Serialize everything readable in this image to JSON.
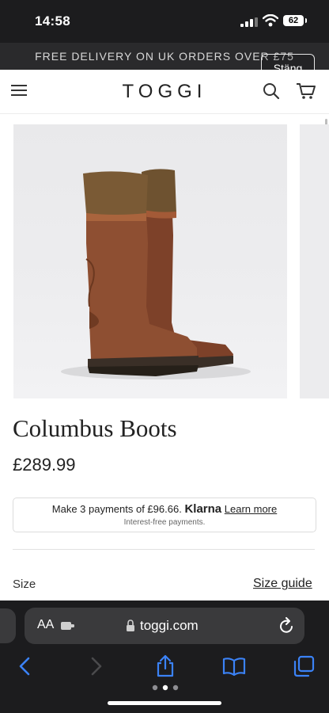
{
  "status_bar": {
    "time": "14:58",
    "battery": "62"
  },
  "promo": {
    "text": "FREE DELIVERY ON UK ORDERS OVER £75",
    "close_label": "Stäng"
  },
  "header": {
    "logo": "TOGGI"
  },
  "product": {
    "title": "Columbus Boots",
    "price": "£289.99",
    "klarna": {
      "prefix": "Make 3 payments of £96.66.",
      "brand": "Klarna",
      "learn_more": "Learn more",
      "note": "Interest-free payments."
    },
    "size_label": "Size",
    "size_guide": "Size guide"
  },
  "browser": {
    "text_size_label": "AA",
    "url": "toggi.com",
    "tab_dots": 3,
    "active_dot": 2
  },
  "colors": {
    "boot_leather": "#8e4f32",
    "boot_cuff": "#7a5a35",
    "toolbar_blue": "#3b82f6"
  },
  "icons": [
    "hamburger-icon",
    "search-icon",
    "cart-icon",
    "extension-icon",
    "lock-icon",
    "reload-icon",
    "back-icon",
    "forward-icon",
    "share-icon",
    "bookmarks-icon",
    "tabs-icon"
  ]
}
